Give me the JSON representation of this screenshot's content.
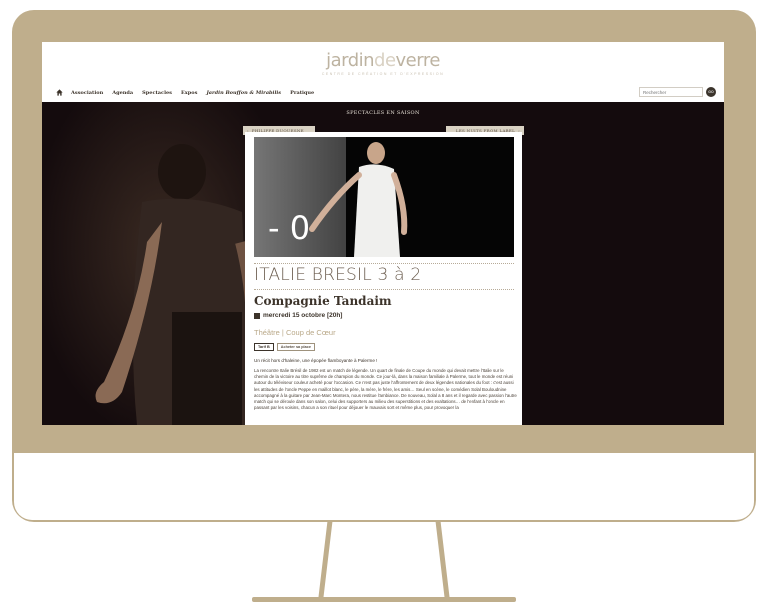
{
  "site": {
    "logo_main": "jardin",
    "logo_de": "de",
    "logo_end": "verre",
    "tagline": "CENTRE DE CRÉATION ET D'EXPRESSION"
  },
  "nav": {
    "items": [
      "Association",
      "Agenda",
      "Spectacles",
      "Expos",
      "Jardin Bouffon & Mirabilis",
      "Pratique"
    ]
  },
  "search": {
    "placeholder": "Rechercher",
    "button": "GO"
  },
  "hero": {
    "section_title": "SPECTACLES EN SAISON",
    "prev_label": "PHILIPPE DUQUESNE",
    "next_label": "LES NUITS FROM LABEL"
  },
  "show": {
    "title": "ITALIE BRESIL 3 à 2",
    "company": "Compagnie Tandaim",
    "date": "mercredi 15 octobre [20h]",
    "genre": "Théâtre | Coup de Cœur",
    "badge_tarif": "Tarif B",
    "badge_buy": "Acheter sa place",
    "lead": "Un récit hors d'haleine, une épopée flamboyante à Palerme !",
    "body": "La rencontre Italie Brésil de 1982 est un match de légende. Un quart de finale de Coupe du monde qui devait mettre l'Italie sur le chemin de la victoire au titre suprême de champion du monde. Ce jour-là, dans la maison familiale à Palerme, tout le monde est réuni autour du téléviseur couleur acheté pour l'occasion. Ce n'est pas juste l'affrontement de deux légendes nationales du foot : c'est aussi les attitudes de l'oncle Peppe en maillot blanc, le père, la mère, le frère, les amis… Seul en scène, le comédien Solal Bouloudnine accompagné à la guitare par Jean-Marc Montera, nous restitue l'ambiance. De nouveau, Solal a 8 ans et il regarde avec passion l'autre match qui se déroule dans son salon, celui des supporters au milieu des superstitions et des exaltations… de l'enfant à l'oncle en passant par les voisins, chacun a son rituel pour déjouer le mauvais sort et même plus, pour provoquer la"
  },
  "photo": {
    "score_text": "- 0"
  },
  "colors": {
    "frame": "#bfae8c",
    "hero_bg": "#140b0d",
    "accent": "#b9a888"
  },
  "icons": [
    "home-icon",
    "calendar-icon",
    "chevron-left-icon",
    "chevron-right-icon"
  ]
}
